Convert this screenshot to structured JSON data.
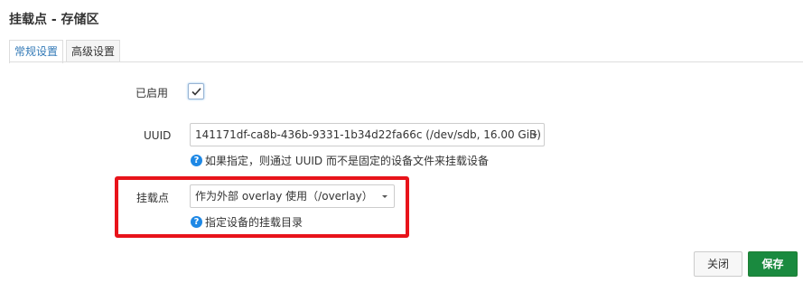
{
  "page": {
    "title": "挂载点 - 存储区"
  },
  "tabs": [
    {
      "label": "常规设置",
      "active": true
    },
    {
      "label": "高级设置",
      "active": false
    }
  ],
  "form": {
    "enabled": {
      "label": "已启用",
      "checked": true
    },
    "uuid": {
      "label": "UUID",
      "value": "141171df-ca8b-436b-9331-1b34d22fa66c (/dev/sdb, 16.00 GiB)",
      "help": "如果指定，则通过 UUID 而不是固定的设备文件来挂载设备"
    },
    "mountpoint": {
      "label": "挂载点",
      "value": "作为外部 overlay 使用（/overlay）",
      "help": "指定设备的挂载目录"
    }
  },
  "footer": {
    "close_label": "关闭",
    "save_label": "保存"
  },
  "colors": {
    "tab_active_text": "#337ab7",
    "highlight_border": "#e8131a",
    "save_button": "#1a8a3f",
    "help_icon": "#1e88e5"
  },
  "icons": {
    "checkbox": "check-icon",
    "help": "question-circle-icon",
    "dropdown": "caret-down-icon"
  }
}
